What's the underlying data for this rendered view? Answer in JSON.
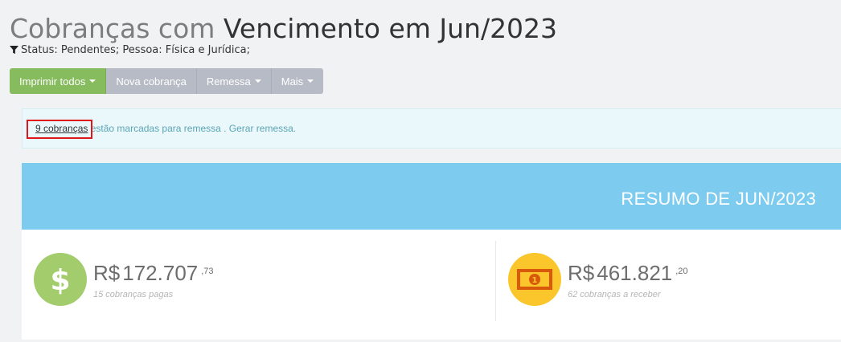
{
  "title": {
    "light": "Cobranças com",
    "dark": "Vencimento em Jun/2023"
  },
  "filter": {
    "icon": "filter-icon",
    "text": "Status: Pendentes; Pessoa: Física e Jurídica;"
  },
  "toolbar": {
    "print_all": "Imprimir todos",
    "new_charge": "Nova cobrança",
    "remittance": "Remessa",
    "more": "Mais"
  },
  "alert": {
    "link": "9 cobranças",
    "text": " estão marcadas para remessa . Gerar remessa."
  },
  "summary": {
    "header": "RESUMO DE JUN/2023",
    "paid": {
      "icon": "dollar-icon",
      "currency": "R$",
      "amount": "172.707",
      "cents": ",73",
      "caption": "15 cobranças pagas"
    },
    "receivable": {
      "icon": "banknote-icon",
      "currency": "R$",
      "amount": "461.821",
      "cents": ",20",
      "caption": "62 cobranças a receber"
    }
  },
  "colors": {
    "primary_button": "#86bb5e",
    "header_bg": "#7dcbee",
    "paid_circle": "#a3cc6c",
    "receivable_circle": "#fbc62b",
    "highlight_border": "#e0161b"
  }
}
